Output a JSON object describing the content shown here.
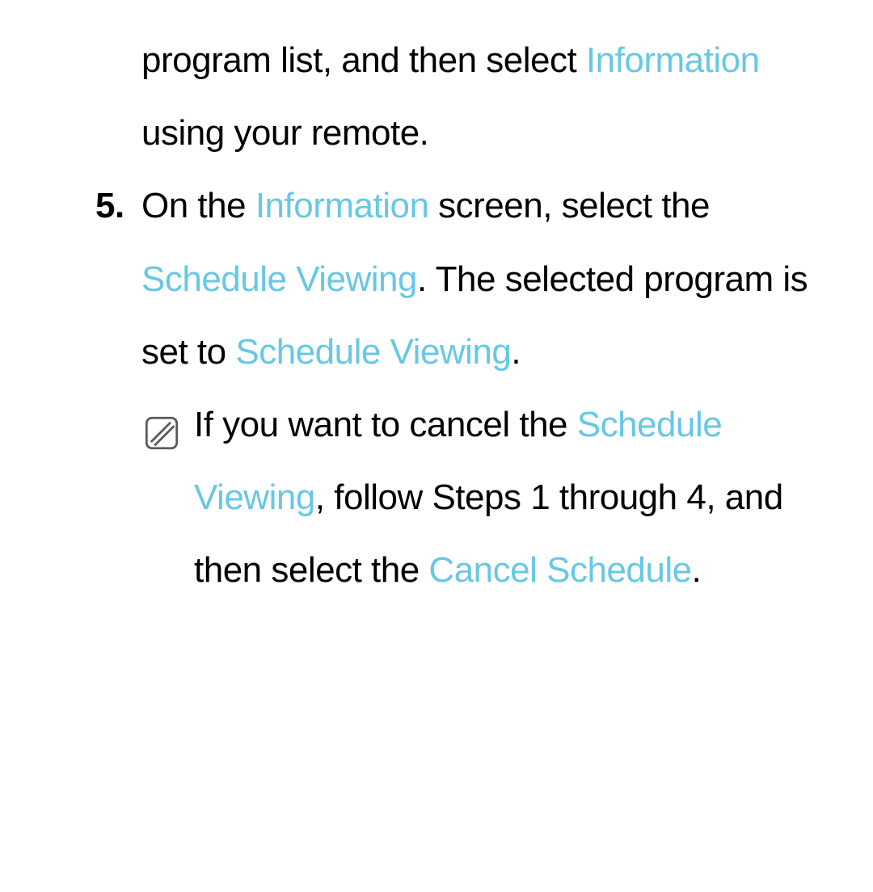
{
  "intro": {
    "t1": "program list, and then select ",
    "hl1": "Information",
    "t2": " using your remote."
  },
  "step": {
    "marker": "5.",
    "t1": "On the ",
    "hl1": "Information",
    "t2": " screen, select the ",
    "hl2": "Schedule Viewing",
    "t3": ". The selected program is set to ",
    "hl3": "Schedule Viewing",
    "t4": "."
  },
  "note": {
    "t1": "If you want to cancel the ",
    "hl1": "Schedule Viewing",
    "t2": ", follow Steps 1 through 4, and then select the ",
    "hl2": "Cancel Schedule",
    "t3": "."
  },
  "colors": {
    "highlight": "#67c8e4",
    "iconStroke": "#58595b"
  }
}
